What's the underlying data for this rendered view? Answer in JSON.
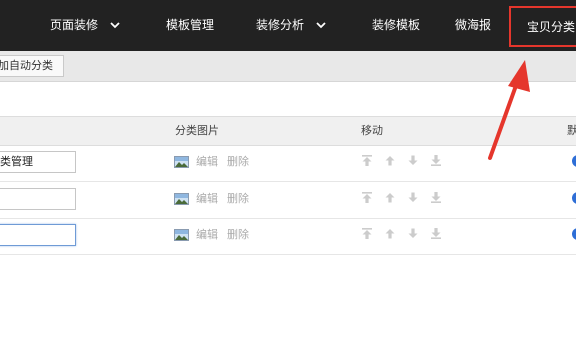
{
  "nav": {
    "items": [
      {
        "label": "页面装修",
        "dropdown": true
      },
      {
        "label": "模板管理",
        "dropdown": false
      },
      {
        "label": "装修分析",
        "dropdown": true
      },
      {
        "label": "装修模板",
        "dropdown": false
      },
      {
        "label": "微海报",
        "dropdown": false
      },
      {
        "label": "宝贝分类",
        "dropdown": false,
        "active": true
      }
    ]
  },
  "toolbar": {
    "add_auto_category": "加自动分类"
  },
  "table": {
    "headers": {
      "image": "分类图片",
      "move": "移动",
      "default": "默"
    },
    "rows": [
      {
        "name": "类管理",
        "edit": "编辑",
        "delete": "删除"
      },
      {
        "name": "",
        "edit": "编辑",
        "delete": "删除"
      },
      {
        "name": "",
        "edit": "编辑",
        "delete": "删除"
      }
    ]
  },
  "colors": {
    "nav_bg": "#222222",
    "highlight": "#e5362c",
    "toggle": "#2e6ed6"
  },
  "icons": [
    "chevron-down-icon",
    "image-icon",
    "move-top-icon",
    "move-up-icon",
    "move-down-icon",
    "move-bottom-icon",
    "red-arrow-annotation"
  ]
}
